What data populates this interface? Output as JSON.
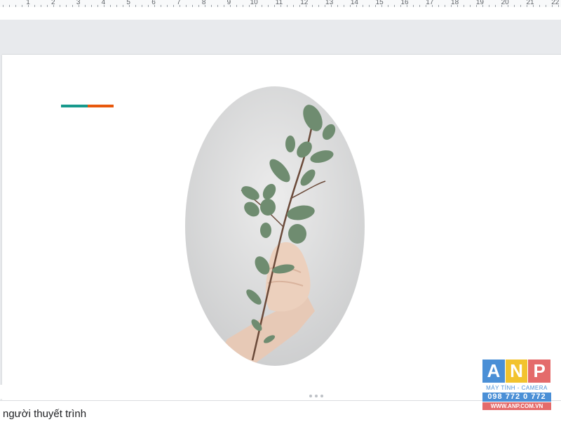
{
  "ruler": {
    "labels": [
      "1",
      "2",
      "3",
      "4",
      "5",
      "6",
      "7",
      "8",
      "9",
      "10",
      "11",
      "12",
      "13",
      "14",
      "15",
      "16",
      "17",
      "18",
      "19",
      "20",
      "21",
      "22"
    ]
  },
  "slide": {
    "accent_colors": [
      "#17998c",
      "#e8580c"
    ]
  },
  "image": {
    "subject": "hand-holding-eucalyptus-branch"
  },
  "notes": {
    "text": "người thuyết trình"
  },
  "watermark": {
    "letters": [
      "A",
      "N",
      "P"
    ],
    "letter_colors": [
      "#4a8fd6",
      "#f2c32e",
      "#e46b6b"
    ],
    "tagline": "MÁY TÍNH - CAMERA",
    "phone": "098 772 0 772",
    "website": "WWW.ANP.COM.VN"
  }
}
